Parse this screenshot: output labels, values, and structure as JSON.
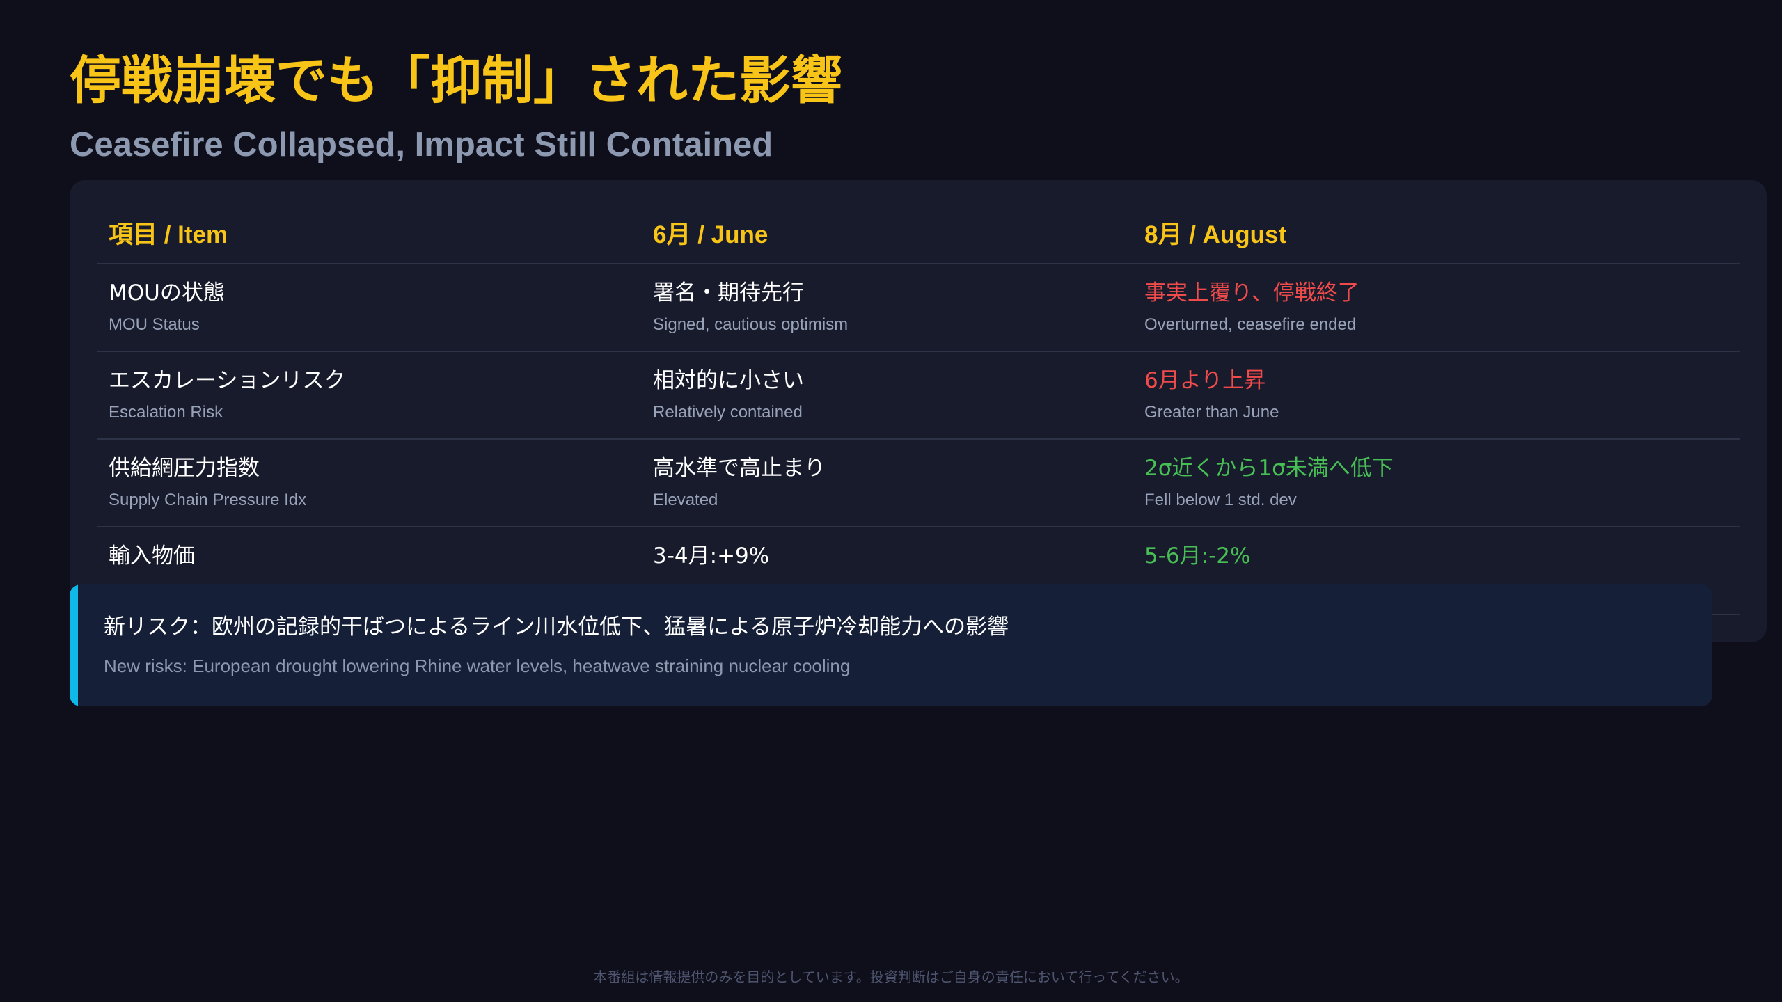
{
  "title": "停戦崩壊でも「抑制」された影響",
  "subtitle": "Ceasefire Collapsed, Impact Still Contained",
  "table": {
    "headers": [
      "項目 / Item",
      "6月 / June",
      "8月 / August"
    ],
    "rows": [
      {
        "item_ja": "MOUの状態",
        "item_en": "MOU Status",
        "june_ja": "署名・期待先行",
        "june_en": "Signed, cautious optimism",
        "aug_ja": "事実上覆り、停戦終了",
        "aug_en": "Overturned, ceasefire ended",
        "aug_color": "#ef4b4b"
      },
      {
        "item_ja": "エスカレーションリスク",
        "item_en": "Escalation Risk",
        "june_ja": "相対的に小さい",
        "june_en": "Relatively contained",
        "aug_ja": "6月より上昇",
        "aug_en": "Greater than June",
        "aug_color": "#ef4b4b"
      },
      {
        "item_ja": "供給網圧力指数",
        "item_en": "Supply Chain Pressure Idx",
        "june_ja": "高水準で高止まり",
        "june_en": "Elevated",
        "aug_ja": "2σ近くから1σ未満へ低下",
        "aug_en": "Fell below 1 std. dev",
        "aug_color": "#48bf55"
      },
      {
        "item_ja": "輸入物価",
        "item_en": "",
        "june_ja": "3-4月:+9%",
        "june_en": "",
        "aug_ja": "5-6月:-2%",
        "aug_en": "",
        "aug_color": "#48bf55"
      }
    ]
  },
  "note": {
    "ja": "新リスク：欧州の記録的干ばつによるライン川水位低下、猛暑による原子炉冷却能力への影響",
    "en": "New risks: European drought lowering Rhine water levels, heatwave straining nuclear cooling"
  },
  "disclaimer": "本番組は情報提供のみを目的としています。投資判断はご自身の責任において行ってください。",
  "colors": {
    "background": "#0e0f1a",
    "accent": "#f7c417",
    "negative": "#ef4b4b",
    "positive": "#48bf55",
    "note_bar": "#0fb9e8"
  }
}
